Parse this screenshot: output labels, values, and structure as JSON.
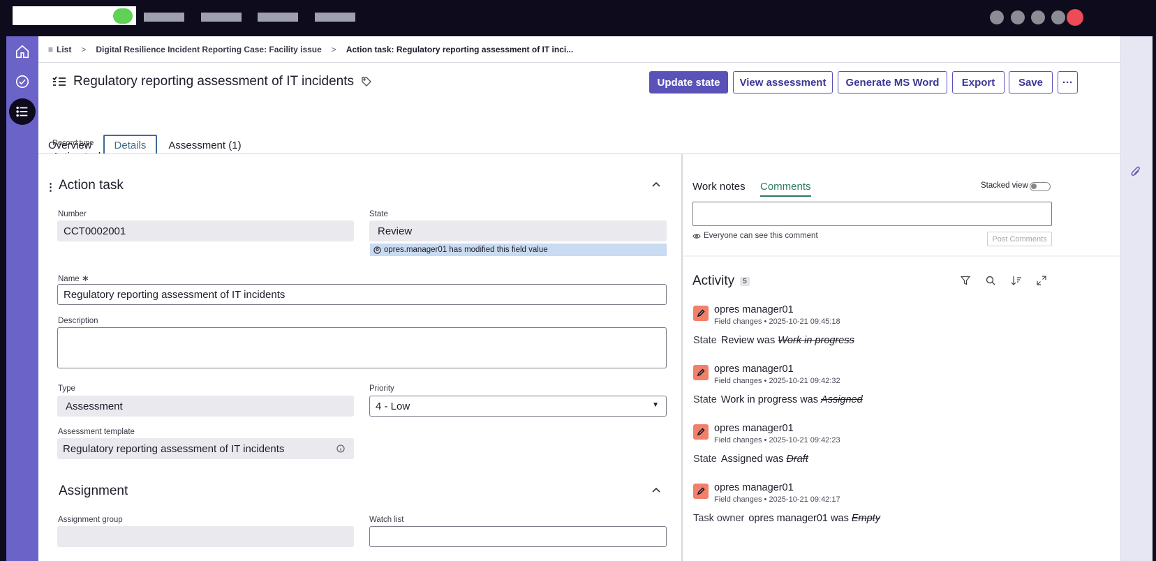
{
  "breadcrumb": {
    "list": "List",
    "case": "Digital Resilience Incident Reporting Case: Facility issue",
    "current": "Action task: Regulatory reporting assessment of IT inci..."
  },
  "header": {
    "title": "Regulatory reporting assessment of IT incidents",
    "record_type_label": "Record type",
    "record_type": "Action task",
    "buttons": {
      "update_state": "Update state",
      "view_assessment": "View assessment",
      "generate_word": "Generate MS Word",
      "export": "Export",
      "save": "Save",
      "more": "···"
    }
  },
  "tabs": [
    "Overview",
    "Details",
    "Assessment (1)"
  ],
  "form": {
    "section_title": "Action task",
    "number_label": "Number",
    "number": "CCT0002001",
    "state_label": "State",
    "state": "Review",
    "state_notice": "opres.manager01 has modified this field value",
    "name_label": "Name",
    "name_required": "∗",
    "name": "Regulatory reporting assessment of IT incidents",
    "description_label": "Description",
    "description": "",
    "type_label": "Type",
    "type": "Assessment",
    "priority_label": "Priority",
    "priority": "4 - Low",
    "template_label": "Assessment template",
    "template": "Regulatory reporting assessment of IT incidents",
    "assignment_title": "Assignment",
    "assignment_group_label": "Assignment group",
    "watch_list_label": "Watch list"
  },
  "side": {
    "tab_work_notes": "Work notes",
    "tab_comments": "Comments",
    "stacked_view": "Stacked view",
    "comment_hint": "Everyone can see this comment",
    "post_button": "Post Comments",
    "activity_title": "Activity",
    "activity_count": "5"
  },
  "activity": [
    {
      "user": "opres manager01",
      "meta": "Field changes • 2025-10-21 09:45:18",
      "field": "State",
      "new": "Review was",
      "old": "Work in progress"
    },
    {
      "user": "opres manager01",
      "meta": "Field changes • 2025-10-21 09:42:32",
      "field": "State",
      "new": "Work in progress was",
      "old": "Assigned"
    },
    {
      "user": "opres manager01",
      "meta": "Field changes • 2025-10-21 09:42:23",
      "field": "State",
      "new": "Assigned was",
      "old": "Draft"
    },
    {
      "user": "opres manager01",
      "meta": "Field changes • 2025-10-21 09:42:17",
      "field": "Task owner",
      "new": "opres manager01 was",
      "old": "Empty"
    }
  ],
  "colors": {
    "brand": "#5a52b8",
    "rail": "#6b63c7",
    "activity_icon": "#f1806a",
    "notice": "#c9dbf0",
    "comments_tab": "#2e7a5a"
  },
  "icons": [
    "home-icon",
    "check-circle-icon",
    "list-icon",
    "tag-icon",
    "task-list-icon",
    "collapse-icon",
    "info-icon",
    "eye-icon",
    "filter-icon",
    "search-icon",
    "sort-icon",
    "expand-icon",
    "pencil-icon",
    "paperclip-icon",
    "kebab-icon"
  ]
}
